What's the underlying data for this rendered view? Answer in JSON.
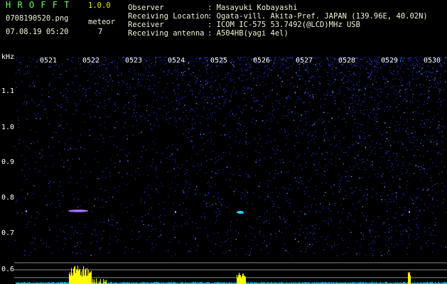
{
  "app": {
    "title": "H R O F F T",
    "version": "1.0.0",
    "filename": "0708190520.png",
    "datetime": "07.08.19 05:20",
    "meteor_label": "meteor",
    "meteor_count": "7"
  },
  "info": {
    "observer_label": "Observer",
    "observer_value": ": Masayuki Kobayashi",
    "location_label": "Receiving Location",
    "location_value": ": Ogata-vill. Akita-Pref. JAPAN (139.96E, 40.02N)",
    "receiver_label": "Receiver",
    "receiver_value": ": ICOM IC-575 53.7492(@LCD)MHz USB",
    "antenna_label": "Receiving antenna",
    "antenna_value": ": A504HB(yagi 4el)"
  },
  "spectrogram": {
    "y_unit": "kHz",
    "y_ticks": [
      "1.1",
      "1.0",
      "0.9",
      "0.8",
      "0.7",
      "0.6"
    ],
    "time_ticks": [
      "0521",
      "0522",
      "0523",
      "0524",
      "0525",
      "0526",
      "0527",
      "0528",
      "0529",
      "0530"
    ],
    "colors": {
      "background": "#000000",
      "noise": "#1a2aa0",
      "accent": "#ffff00",
      "meteor_echo": "#b070ff",
      "baseline": "#00c8ff"
    }
  }
}
